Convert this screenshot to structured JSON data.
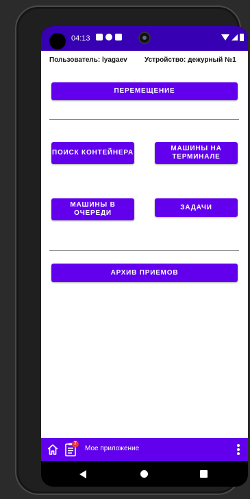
{
  "status_bar": {
    "time": "04:13",
    "icons_left": [
      "notification-icon",
      "circle-status-icon",
      "sim-icon"
    ],
    "icons_right": [
      "wifi-icon",
      "signal-icon",
      "battery-icon"
    ]
  },
  "header": {
    "user_label": "Пользователь: lyagaev",
    "device_label": "Устройство: дежурный №1"
  },
  "buttons": {
    "move": "ПЕРЕМЕЩЕНИЕ",
    "container_search": "ПОИСК КОНТЕЙНЕРА",
    "cars_on_terminal": "МАШИНЫ НА ТЕРМИНАЛЕ",
    "cars_in_queue": "МАШИНЫ В ОЧЕРЕДИ",
    "tasks": "ЗАДАЧИ",
    "receipt_archive": "АРХИВ ПРИЕМОВ"
  },
  "app_bar": {
    "title": "Мое приложение",
    "tasks_badge": "7"
  },
  "colors": {
    "primary": "#6200ee",
    "primary_dark": "#3700b3",
    "badge": "#e53935"
  }
}
